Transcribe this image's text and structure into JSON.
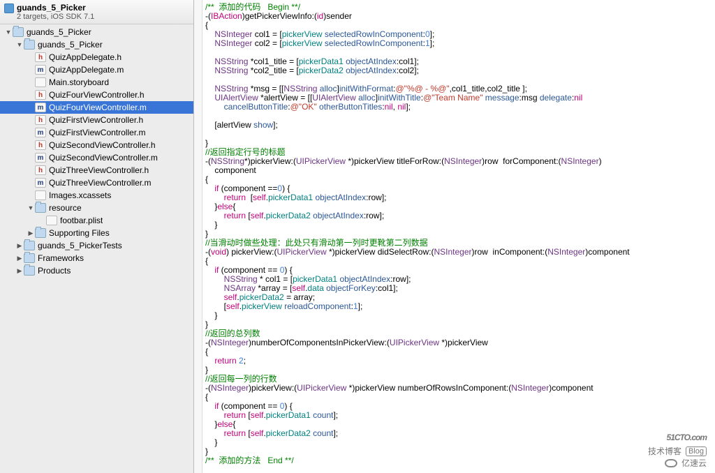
{
  "project": {
    "title": "guands_5_Picker",
    "subtitle": "2 targets, iOS SDK 7.1"
  },
  "tree": [
    {
      "depth": 0,
      "arrow": "open",
      "icon": "folder",
      "label": "guands_5_Picker"
    },
    {
      "depth": 1,
      "arrow": "open",
      "icon": "folder",
      "label": "guands_5_Picker"
    },
    {
      "depth": 2,
      "arrow": "none",
      "icon": "h",
      "iconText": "h",
      "label": "QuizAppDelegate.h"
    },
    {
      "depth": 2,
      "arrow": "none",
      "icon": "m",
      "iconText": "m",
      "label": "QuizAppDelegate.m"
    },
    {
      "depth": 2,
      "arrow": "none",
      "icon": "sb",
      "iconText": "",
      "label": "Main.storyboard"
    },
    {
      "depth": 2,
      "arrow": "none",
      "icon": "h",
      "iconText": "h",
      "label": "QuizFourViewController.h"
    },
    {
      "depth": 2,
      "arrow": "none",
      "icon": "m",
      "iconText": "m",
      "label": "QuizFourViewController.m",
      "selected": true
    },
    {
      "depth": 2,
      "arrow": "none",
      "icon": "h",
      "iconText": "h",
      "label": "QuizFirstViewController.h"
    },
    {
      "depth": 2,
      "arrow": "none",
      "icon": "m",
      "iconText": "m",
      "label": "QuizFirstViewController.m"
    },
    {
      "depth": 2,
      "arrow": "none",
      "icon": "h",
      "iconText": "h",
      "label": "QuizSecondViewController.h"
    },
    {
      "depth": 2,
      "arrow": "none",
      "icon": "m",
      "iconText": "m",
      "label": "QuizSecondViewController.m"
    },
    {
      "depth": 2,
      "arrow": "none",
      "icon": "h",
      "iconText": "h",
      "label": "QuizThreeViewController.h"
    },
    {
      "depth": 2,
      "arrow": "none",
      "icon": "m",
      "iconText": "m",
      "label": "QuizThreeViewController.m"
    },
    {
      "depth": 2,
      "arrow": "none",
      "icon": "xc",
      "iconText": "",
      "label": "Images.xcassets"
    },
    {
      "depth": 2,
      "arrow": "open",
      "icon": "folder",
      "label": "resource"
    },
    {
      "depth": 3,
      "arrow": "none",
      "icon": "sb",
      "iconText": "",
      "label": "footbar.plist"
    },
    {
      "depth": 2,
      "arrow": "closed",
      "icon": "folder",
      "label": "Supporting Files"
    },
    {
      "depth": 1,
      "arrow": "closed",
      "icon": "folder",
      "label": "guands_5_PickerTests"
    },
    {
      "depth": 1,
      "arrow": "closed",
      "icon": "folder",
      "label": "Frameworks"
    },
    {
      "depth": 1,
      "arrow": "closed",
      "icon": "folder",
      "label": "Products"
    }
  ],
  "code_lines": [
    [
      [
        "c-green",
        "/**  添加的代码   Begin **/"
      ]
    ],
    [
      [
        "",
        "-("
      ],
      [
        "c-pink",
        "IBAction"
      ],
      [
        "",
        ")getPickerViewInfo:("
      ],
      [
        "c-pink",
        "id"
      ],
      [
        "",
        ")sender"
      ]
    ],
    [
      [
        "",
        "{"
      ]
    ],
    [
      [
        "",
        "    "
      ],
      [
        "c-purple",
        "NSInteger"
      ],
      [
        "",
        " col1 = ["
      ],
      [
        "c-teal",
        "pickerView"
      ],
      [
        "",
        " "
      ],
      [
        "c-blue",
        "selectedRowInComponent"
      ],
      [
        "",
        ":"
      ],
      [
        "c-ltblue",
        "0"
      ],
      [
        "",
        "];"
      ]
    ],
    [
      [
        "",
        "    "
      ],
      [
        "c-purple",
        "NSInteger"
      ],
      [
        "",
        " col2 = ["
      ],
      [
        "c-teal",
        "pickerView"
      ],
      [
        "",
        " "
      ],
      [
        "c-blue",
        "selectedRowInComponent"
      ],
      [
        "",
        ":"
      ],
      [
        "c-ltblue",
        "1"
      ],
      [
        "",
        "];"
      ]
    ],
    [
      [
        "",
        ""
      ]
    ],
    [
      [
        "",
        "    "
      ],
      [
        "c-purple",
        "NSString"
      ],
      [
        "",
        " *col1_title = ["
      ],
      [
        "c-teal",
        "pickerData1"
      ],
      [
        "",
        " "
      ],
      [
        "c-blue",
        "objectAtIndex"
      ],
      [
        "",
        ":col1];"
      ]
    ],
    [
      [
        "",
        "    "
      ],
      [
        "c-purple",
        "NSString"
      ],
      [
        "",
        " *col2_title = ["
      ],
      [
        "c-teal",
        "pickerData2"
      ],
      [
        "",
        " "
      ],
      [
        "c-blue",
        "objectAtIndex"
      ],
      [
        "",
        ":col2];"
      ]
    ],
    [
      [
        "",
        ""
      ]
    ],
    [
      [
        "",
        "    "
      ],
      [
        "c-purple",
        "NSString"
      ],
      [
        "",
        " *msg = [["
      ],
      [
        "c-purple",
        "NSString"
      ],
      [
        "",
        " "
      ],
      [
        "c-blue",
        "alloc"
      ],
      [
        "",
        "]"
      ],
      [
        "c-blue",
        "initWithFormat"
      ],
      [
        "",
        ":"
      ],
      [
        "c-red",
        "@\"%@ - %@\""
      ],
      [
        "",
        ",col1_title,col2_title ];"
      ]
    ],
    [
      [
        "",
        "    "
      ],
      [
        "c-purple",
        "UIAlertView"
      ],
      [
        "",
        " *alertView = [["
      ],
      [
        "c-purple",
        "UIAlertView"
      ],
      [
        "",
        " "
      ],
      [
        "c-blue",
        "alloc"
      ],
      [
        "",
        "]"
      ],
      [
        "c-blue",
        "initWithTitle"
      ],
      [
        "",
        ":"
      ],
      [
        "c-red",
        "@\"Team Name\""
      ],
      [
        "",
        " "
      ],
      [
        "c-blue",
        "message"
      ],
      [
        "",
        ":msg "
      ],
      [
        "c-blue",
        "delegate"
      ],
      [
        "",
        ":"
      ],
      [
        "c-pink",
        "nil"
      ]
    ],
    [
      [
        "",
        "        "
      ],
      [
        "c-blue",
        "cancelButtonTitle"
      ],
      [
        "",
        ":"
      ],
      [
        "c-red",
        "@\"OK\""
      ],
      [
        "",
        " "
      ],
      [
        "c-blue",
        "otherButtonTitles"
      ],
      [
        "",
        ":"
      ],
      [
        "c-pink",
        "nil"
      ],
      [
        "",
        ", "
      ],
      [
        "c-pink",
        "nil"
      ],
      [
        "",
        "];"
      ]
    ],
    [
      [
        "",
        ""
      ]
    ],
    [
      [
        "",
        "    [alertView "
      ],
      [
        "c-blue",
        "show"
      ],
      [
        "",
        "];"
      ]
    ],
    [
      [
        "",
        ""
      ]
    ],
    [
      [
        "",
        "}"
      ]
    ],
    [
      [
        "c-green",
        "//返回指定行号的标题"
      ]
    ],
    [
      [
        "",
        "-("
      ],
      [
        "c-purple",
        "NSString"
      ],
      [
        "",
        "*)pickerView:("
      ],
      [
        "c-purple",
        "UIPickerView"
      ],
      [
        "",
        " *)pickerView titleForRow:("
      ],
      [
        "c-purple",
        "NSInteger"
      ],
      [
        "",
        ")row  forComponent:("
      ],
      [
        "c-purple",
        "NSInteger"
      ],
      [
        "",
        ")"
      ]
    ],
    [
      [
        "",
        "    component"
      ]
    ],
    [
      [
        "",
        "{"
      ]
    ],
    [
      [
        "",
        "    "
      ],
      [
        "c-pink",
        "if"
      ],
      [
        "",
        " (component =="
      ],
      [
        "c-ltblue",
        "0"
      ],
      [
        "",
        ") {"
      ]
    ],
    [
      [
        "",
        "        "
      ],
      [
        "c-pink",
        "return"
      ],
      [
        "",
        "  ["
      ],
      [
        "c-pink",
        "self"
      ],
      [
        "",
        "."
      ],
      [
        "c-teal",
        "pickerData1"
      ],
      [
        "",
        " "
      ],
      [
        "c-blue",
        "objectAtIndex"
      ],
      [
        "",
        ":row];"
      ]
    ],
    [
      [
        "",
        "    }"
      ],
      [
        "c-pink",
        "else"
      ],
      [
        "",
        "{"
      ]
    ],
    [
      [
        "",
        "        "
      ],
      [
        "c-pink",
        "return"
      ],
      [
        "",
        " ["
      ],
      [
        "c-pink",
        "self"
      ],
      [
        "",
        "."
      ],
      [
        "c-teal",
        "pickerData2"
      ],
      [
        "",
        " "
      ],
      [
        "c-blue",
        "objectAtIndex"
      ],
      [
        "",
        ":row];"
      ]
    ],
    [
      [
        "",
        "    }"
      ]
    ],
    [
      [
        "",
        "}"
      ]
    ],
    [
      [
        "c-green",
        "//当滑动时做些处理：此处只有滑动第一列时更靴第二列数据"
      ]
    ],
    [
      [
        "",
        "-("
      ],
      [
        "c-pink",
        "void"
      ],
      [
        "",
        ") pickerView:("
      ],
      [
        "c-purple",
        "UIPickerView"
      ],
      [
        "",
        " *)pickerView didSelectRow:("
      ],
      [
        "c-purple",
        "NSInteger"
      ],
      [
        "",
        ")row  inComponent:("
      ],
      [
        "c-purple",
        "NSInteger"
      ],
      [
        "",
        ")component"
      ]
    ],
    [
      [
        "",
        "{"
      ]
    ],
    [
      [
        "",
        "    "
      ],
      [
        "c-pink",
        "if"
      ],
      [
        "",
        " (component == "
      ],
      [
        "c-ltblue",
        "0"
      ],
      [
        "",
        ") {"
      ]
    ],
    [
      [
        "",
        "        "
      ],
      [
        "c-purple",
        "NSString"
      ],
      [
        "",
        " * col1 = ["
      ],
      [
        "c-teal",
        "pickerData1"
      ],
      [
        "",
        " "
      ],
      [
        "c-blue",
        "objectAtIndex"
      ],
      [
        "",
        ":row];"
      ]
    ],
    [
      [
        "",
        "        "
      ],
      [
        "c-purple",
        "NSArray"
      ],
      [
        "",
        " *array = ["
      ],
      [
        "c-pink",
        "self"
      ],
      [
        "",
        "."
      ],
      [
        "c-teal",
        "data"
      ],
      [
        "",
        " "
      ],
      [
        "c-blue",
        "objectForKey"
      ],
      [
        "",
        ":col1];"
      ]
    ],
    [
      [
        "",
        "        "
      ],
      [
        "c-pink",
        "self"
      ],
      [
        "",
        "."
      ],
      [
        "c-teal",
        "pickerData2"
      ],
      [
        "",
        " = array;"
      ]
    ],
    [
      [
        "",
        "        ["
      ],
      [
        "c-pink",
        "self"
      ],
      [
        "",
        "."
      ],
      [
        "c-teal",
        "pickerView"
      ],
      [
        "",
        " "
      ],
      [
        "c-blue",
        "reloadComponent"
      ],
      [
        "",
        ":"
      ],
      [
        "c-ltblue",
        "1"
      ],
      [
        "",
        "];"
      ]
    ],
    [
      [
        "",
        "    }"
      ]
    ],
    [
      [
        "",
        "}"
      ]
    ],
    [
      [
        "c-green",
        "//返回的总列数"
      ]
    ],
    [
      [
        "",
        "-("
      ],
      [
        "c-purple",
        "NSInteger"
      ],
      [
        "",
        ")numberOfComponentsInPickerView:("
      ],
      [
        "c-purple",
        "UIPickerView"
      ],
      [
        "",
        " *)pickerView"
      ]
    ],
    [
      [
        "",
        "{"
      ]
    ],
    [
      [
        "",
        "    "
      ],
      [
        "c-pink",
        "return"
      ],
      [
        "",
        " "
      ],
      [
        "c-ltblue",
        "2"
      ],
      [
        "",
        ";"
      ]
    ],
    [
      [
        "",
        "}"
      ]
    ],
    [
      [
        "c-green",
        "//返回每一列的行数"
      ]
    ],
    [
      [
        "",
        "-("
      ],
      [
        "c-purple",
        "NSInteger"
      ],
      [
        "",
        ")pickerView:("
      ],
      [
        "c-purple",
        "UIPickerView"
      ],
      [
        "",
        " *)pickerView numberOfRowsInComponent:("
      ],
      [
        "c-purple",
        "NSInteger"
      ],
      [
        "",
        ")component"
      ]
    ],
    [
      [
        "",
        "{"
      ]
    ],
    [
      [
        "",
        "    "
      ],
      [
        "c-pink",
        "if"
      ],
      [
        "",
        " (component == "
      ],
      [
        "c-ltblue",
        "0"
      ],
      [
        "",
        ") {"
      ]
    ],
    [
      [
        "",
        "        "
      ],
      [
        "c-pink",
        "return"
      ],
      [
        "",
        " ["
      ],
      [
        "c-pink",
        "self"
      ],
      [
        "",
        "."
      ],
      [
        "c-teal",
        "pickerData1"
      ],
      [
        "",
        " "
      ],
      [
        "c-blue",
        "count"
      ],
      [
        "",
        "];"
      ]
    ],
    [
      [
        "",
        "    }"
      ],
      [
        "c-pink",
        "else"
      ],
      [
        "",
        "{"
      ]
    ],
    [
      [
        "",
        "        "
      ],
      [
        "c-pink",
        "return"
      ],
      [
        "",
        " ["
      ],
      [
        "c-pink",
        "self"
      ],
      [
        "",
        "."
      ],
      [
        "c-teal",
        "pickerData2"
      ],
      [
        "",
        " "
      ],
      [
        "c-blue",
        "count"
      ],
      [
        "",
        "];"
      ]
    ],
    [
      [
        "",
        "    }"
      ]
    ],
    [
      [
        "",
        "}"
      ]
    ],
    [
      [
        "c-green",
        "/**  添加的方法   End **/"
      ]
    ]
  ],
  "watermark": {
    "big": "51CTO.com",
    "tag": "Blog",
    "small": "技术博客",
    "sub": "亿速云"
  }
}
